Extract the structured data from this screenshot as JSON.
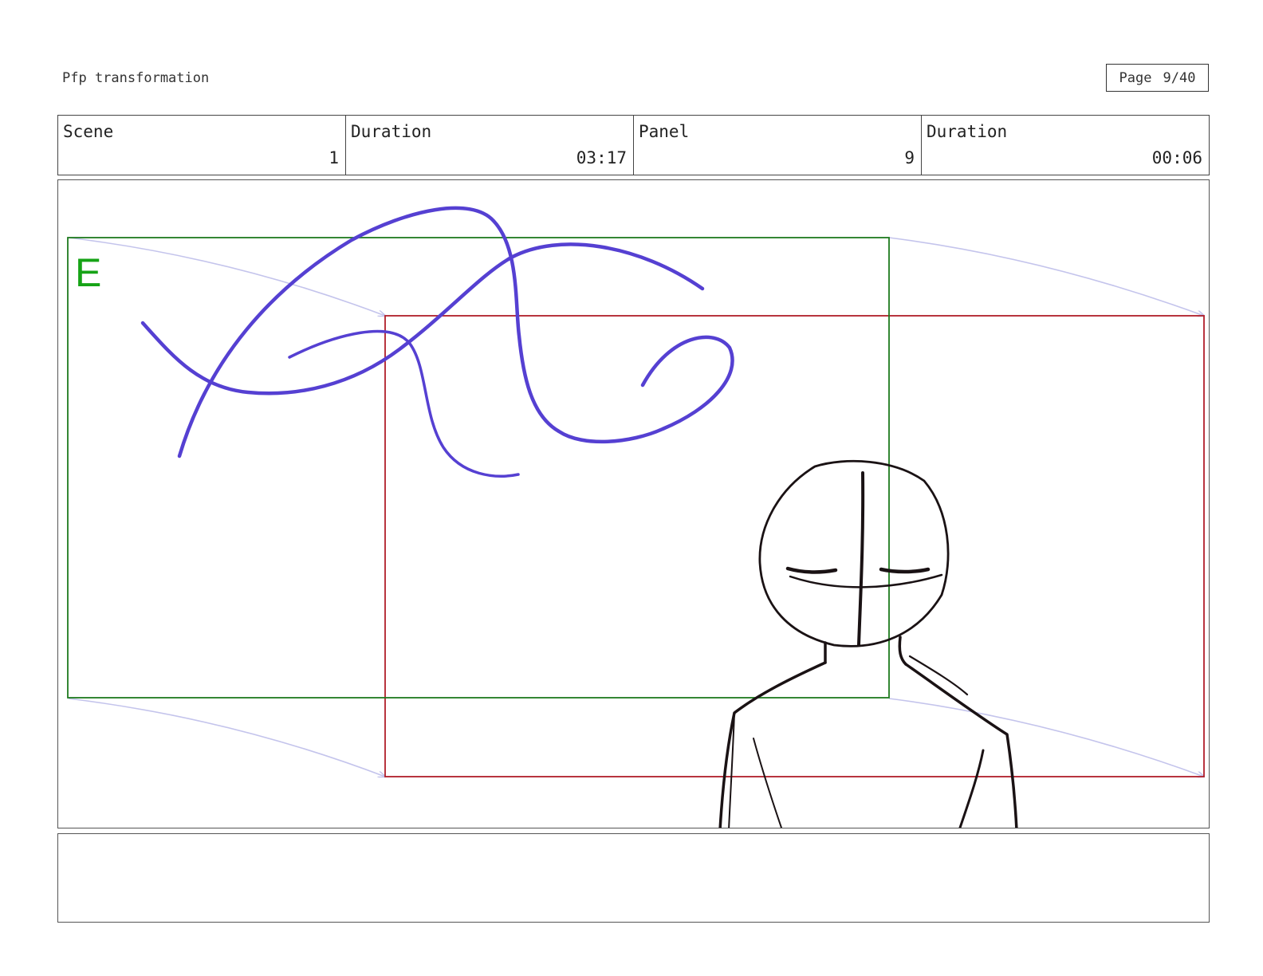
{
  "header": {
    "title": "Pfp transformation",
    "page_label": "Page",
    "page_value": "9/40"
  },
  "info": {
    "scene_label": "Scene",
    "scene_value": "1",
    "scene_duration_label": "Duration",
    "scene_duration_value": "03:17",
    "panel_label": "Panel",
    "panel_value": "9",
    "panel_duration_label": "Duration",
    "panel_duration_value": "00:06"
  },
  "panel": {
    "start_frame_label": "E",
    "colors": {
      "start_frame": "#1e7a1e",
      "start_frame_label": "#16a316",
      "end_frame": "#b01e2a",
      "motion_arrows": "#c4c4ec",
      "swirl": "#5540d2",
      "character": "#1a1214"
    }
  },
  "notes": {
    "text": ""
  }
}
